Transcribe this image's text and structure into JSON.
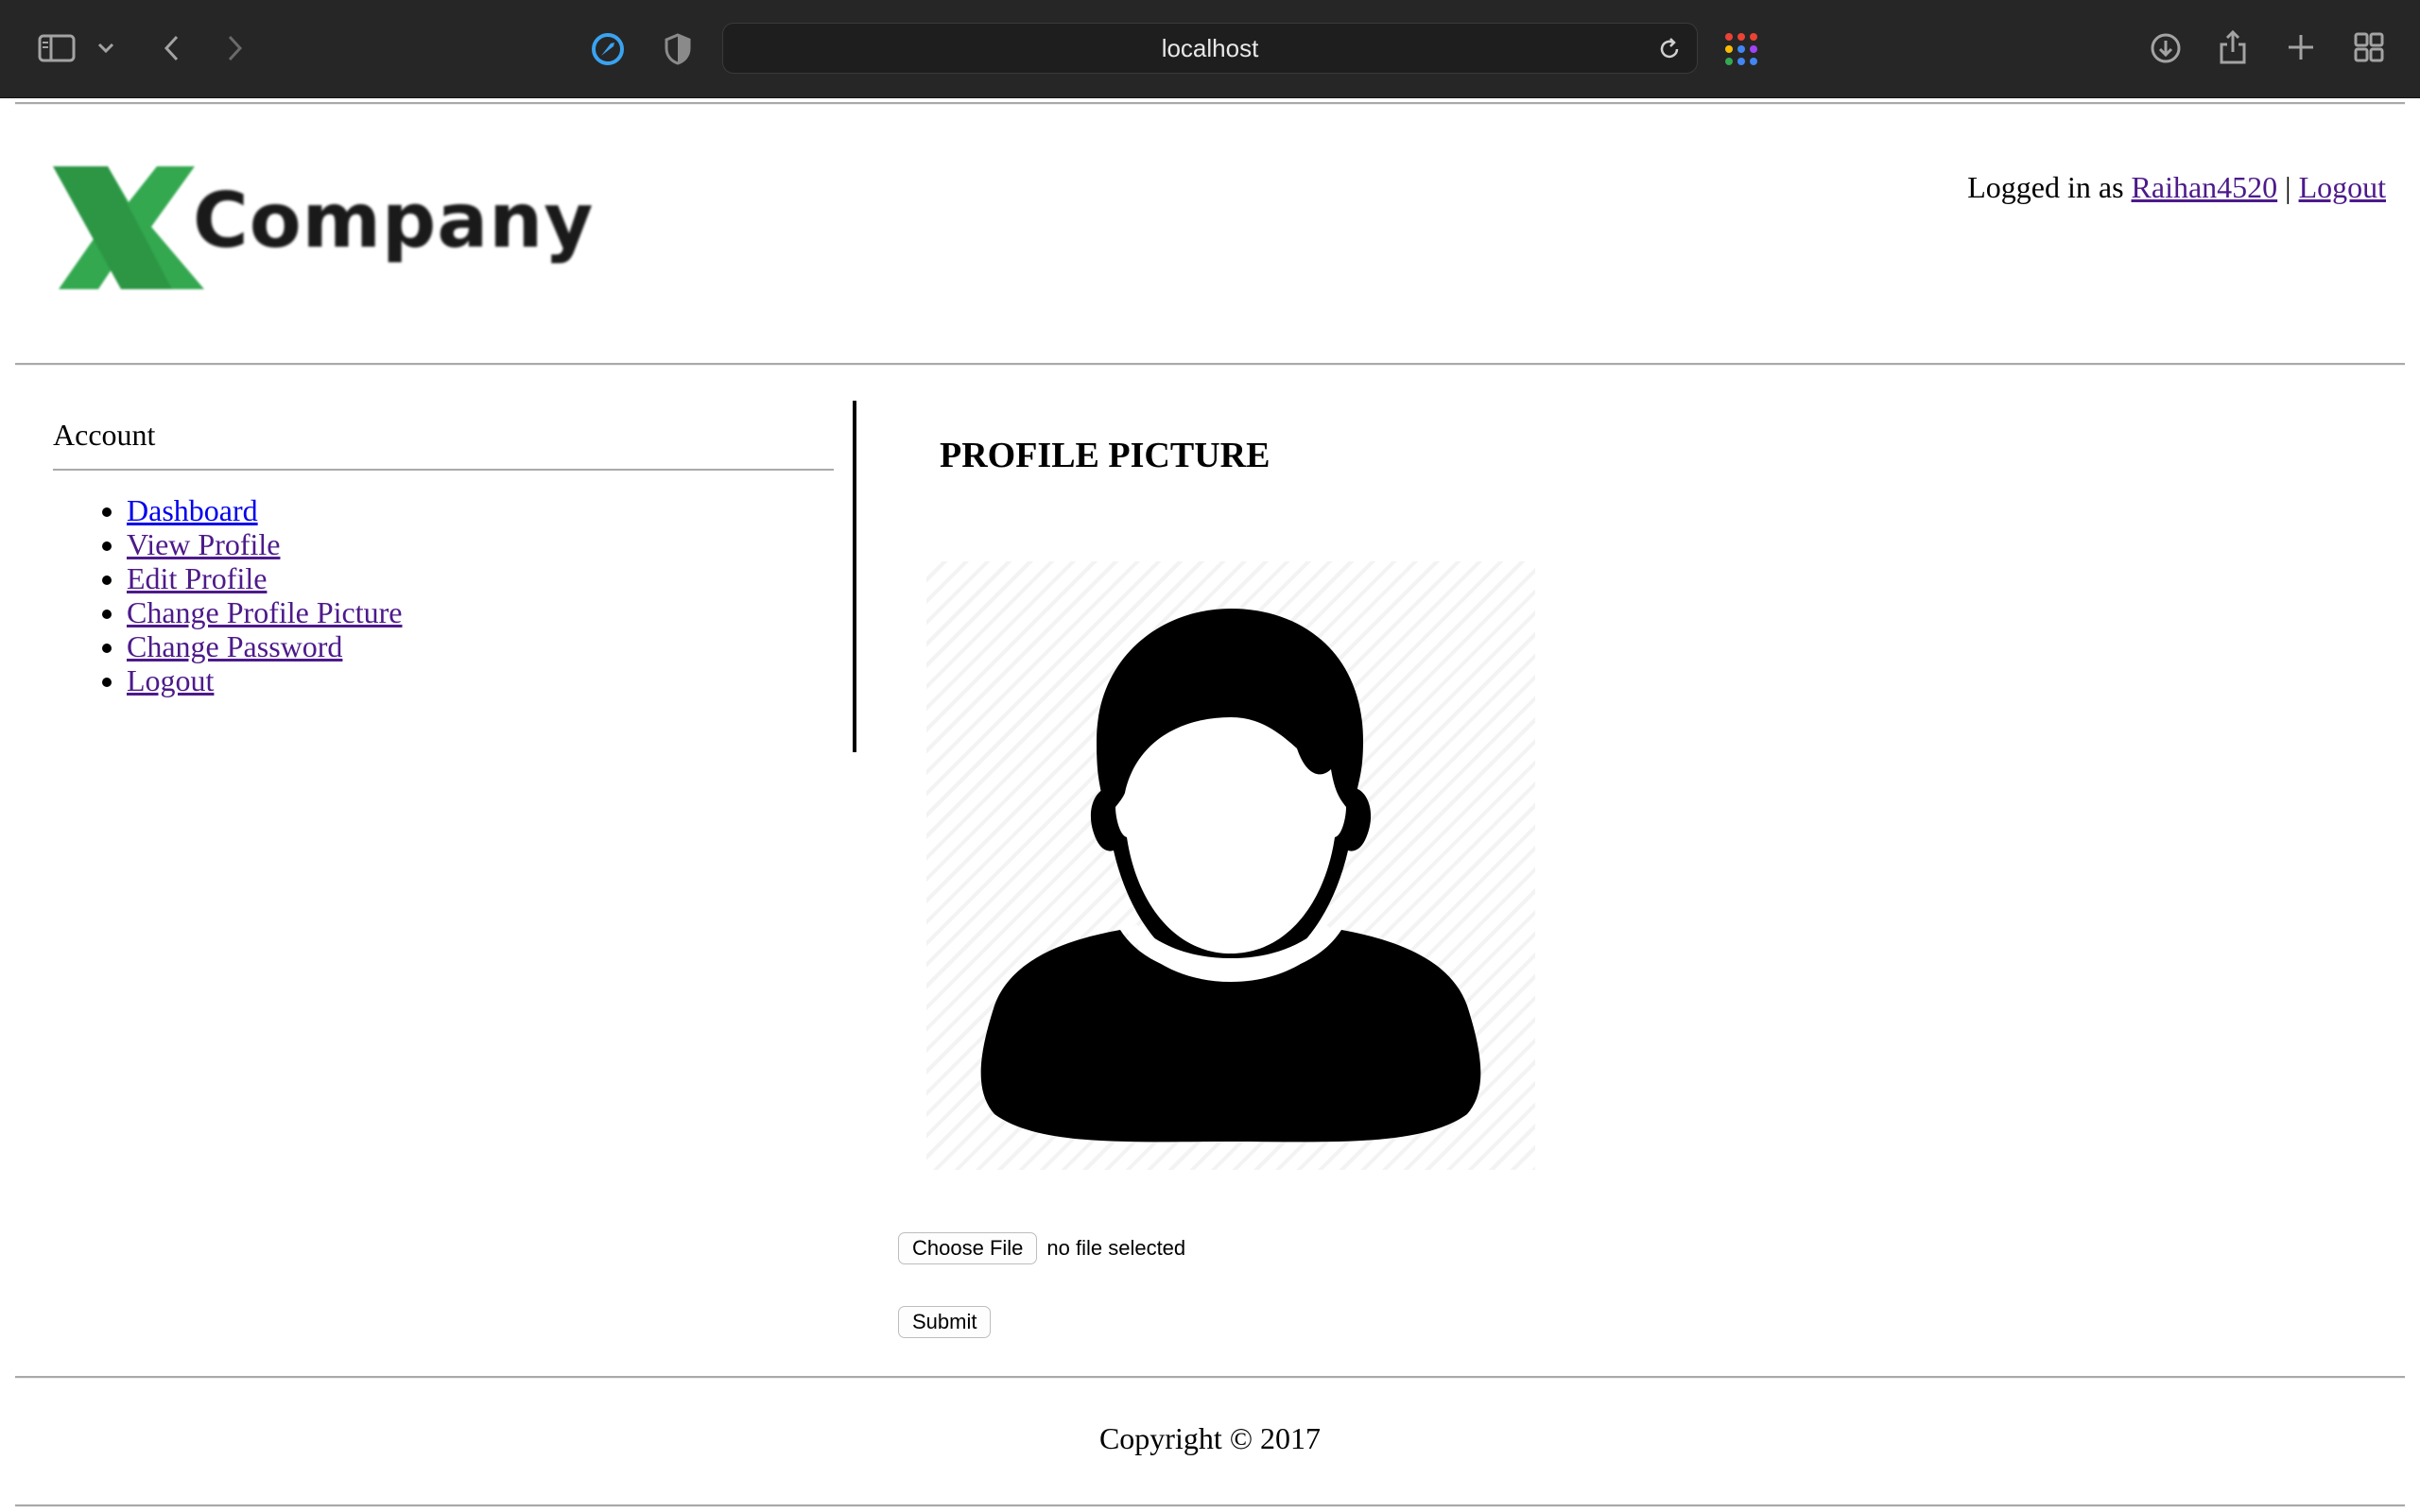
{
  "browser": {
    "url": "localhost",
    "icons": [
      "sidebar-icon",
      "chevron-down-icon",
      "back-icon",
      "forward-icon",
      "privacy-report-icon",
      "shield-icon",
      "reload-icon",
      "extensions-grid-icon",
      "download-icon",
      "share-icon",
      "new-tab-icon",
      "tab-overview-icon"
    ]
  },
  "header": {
    "logo_text": "Company",
    "logo_mark": "X",
    "logged_in_prefix": "Logged in as",
    "username": "Raihan4520",
    "separator": "|",
    "logout_label": "Logout"
  },
  "sidebar": {
    "title": "Account",
    "items": [
      {
        "label": "Dashboard"
      },
      {
        "label": "View Profile"
      },
      {
        "label": "Edit Profile"
      },
      {
        "label": "Change Profile Picture"
      },
      {
        "label": "Change Password"
      },
      {
        "label": "Logout"
      }
    ]
  },
  "main": {
    "title": "PROFILE PICTURE",
    "choose_file_label": "Choose File",
    "file_status": "no file selected",
    "submit_label": "Submit"
  },
  "footer": {
    "copyright": "Copyright © 2017"
  },
  "colors": {
    "chrome_bg": "#262626",
    "visited_link": "#4d1a8a",
    "unvisited_link": "#0000ee",
    "logo_green": "#33a84f"
  }
}
